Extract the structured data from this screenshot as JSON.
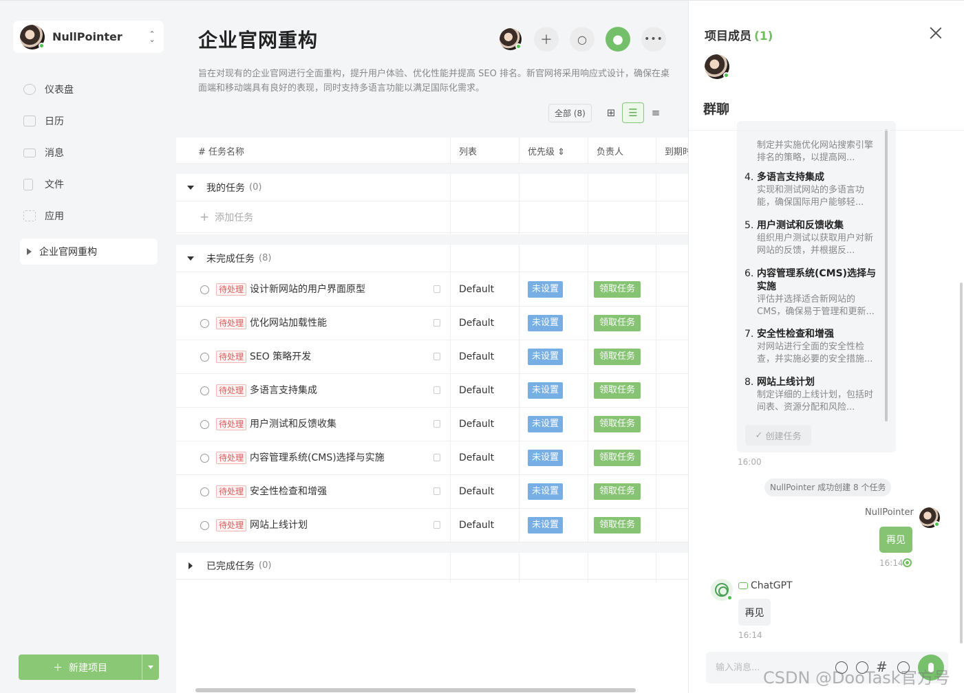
{
  "user": {
    "name": "NullPointer"
  },
  "sidebar": {
    "nav": [
      {
        "label": "仪表盘",
        "icon": "dashboard-icon"
      },
      {
        "label": "日历",
        "icon": "calendar-icon"
      },
      {
        "label": "消息",
        "icon": "message-icon"
      },
      {
        "label": "文件",
        "icon": "file-icon"
      },
      {
        "label": "应用",
        "icon": "apps-icon"
      }
    ],
    "project": "企业官网重构",
    "new_project": "新建项目"
  },
  "main": {
    "title": "企业官网重构",
    "description": "旨在对现有的企业官网进行全面重构，提升用户体验、优化性能并提高 SEO 排名。新官网将采用响应式设计，确保在桌面端和移动端具有良好的表现，同时支持多语言功能以满足国际化需求。",
    "filter": "全部 (8)",
    "columns": [
      "# 任务名称",
      "列表",
      "优先级 ⇕",
      "负责人",
      "到期时"
    ],
    "groups": {
      "mine": {
        "label": "我的任务",
        "count": "(0)"
      },
      "add_task": "添加任务",
      "open": {
        "label": "未完成任务",
        "count": "(8)"
      },
      "done": {
        "label": "已完成任务",
        "count": "(0)"
      }
    },
    "tasks": [
      {
        "tag": "待处理",
        "name": "设计新网站的用户界面原型",
        "list": "Default",
        "priority": "未设置",
        "action": "领取任务"
      },
      {
        "tag": "待处理",
        "name": "优化网站加载性能",
        "list": "Default",
        "priority": "未设置",
        "action": "领取任务"
      },
      {
        "tag": "待处理",
        "name": "SEO 策略开发",
        "list": "Default",
        "priority": "未设置",
        "action": "领取任务"
      },
      {
        "tag": "待处理",
        "name": "多语言支持集成",
        "list": "Default",
        "priority": "未设置",
        "action": "领取任务"
      },
      {
        "tag": "待处理",
        "name": "用户测试和反馈收集",
        "list": "Default",
        "priority": "未设置",
        "action": "领取任务"
      },
      {
        "tag": "待处理",
        "name": "内容管理系统(CMS)选择与实施",
        "list": "Default",
        "priority": "未设置",
        "action": "领取任务"
      },
      {
        "tag": "待处理",
        "name": "安全性检查和增强",
        "list": "Default",
        "priority": "未设置",
        "action": "领取任务"
      },
      {
        "tag": "待处理",
        "name": "网站上线计划",
        "list": "Default",
        "priority": "未设置",
        "action": "领取任务"
      }
    ]
  },
  "panel": {
    "title": "项目成员",
    "member_count": "(1)",
    "group_chat": "群聊",
    "card_items": [
      {
        "num": "",
        "title": "",
        "desc": "制定并实施优化网站搜索引擎排名的策略，以提高网..."
      },
      {
        "num": "4.",
        "title": "多语言支持集成",
        "desc": "实现和测试网站的多语言功能，确保国际用户能够轻..."
      },
      {
        "num": "5.",
        "title": "用户测试和反馈收集",
        "desc": "组织用户测试以获取用户对新网站的反馈，并根据反..."
      },
      {
        "num": "6.",
        "title": "内容管理系统(CMS)选择与实施",
        "desc": "评估并选择适合新网站的 CMS，确保易于管理和更新..."
      },
      {
        "num": "7.",
        "title": "安全性检查和增强",
        "desc": "对网站进行全面的安全性检查，并实施必要的安全措施..."
      },
      {
        "num": "8.",
        "title": "网站上线计划",
        "desc": "制定详细的上线计划，包括时间表、资源分配和风险..."
      }
    ],
    "create_task": "创建任务",
    "card_time": "16:00",
    "system_msg": "NullPointer 成功创建 8 个任务",
    "me_name": "NullPointer",
    "me_msg": "再见",
    "me_time": "16:14",
    "bot_name": "ChatGPT",
    "bot_msg": "再见",
    "bot_time": "16:14",
    "input_placeholder": "输入消息...",
    "watermark": "CSDN @DooTask官方号"
  }
}
